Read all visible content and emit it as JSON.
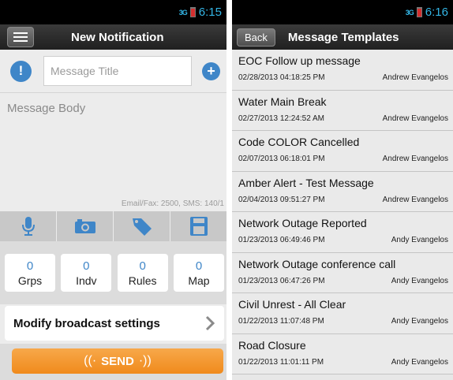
{
  "left_status": {
    "time": "6:15",
    "signal": "3G"
  },
  "right_status": {
    "time": "6:16",
    "signal": "3G"
  },
  "new_notification": {
    "title": "New Notification",
    "message_title_placeholder": "Message Title",
    "message_body_placeholder": "Message Body",
    "limits_text": "Email/Fax: 2500, SMS: 140/1",
    "counters": [
      {
        "value": "0",
        "label": "Grps"
      },
      {
        "value": "0",
        "label": "Indv"
      },
      {
        "value": "0",
        "label": "Rules"
      },
      {
        "value": "0",
        "label": "Map"
      }
    ],
    "modify_label": "Modify broadcast settings",
    "send_label": "SEND"
  },
  "templates": {
    "back_label": "Back",
    "title": "Message Templates",
    "items": [
      {
        "name": "EOC Follow up message",
        "date": "02/28/2013 04:18:25 PM",
        "author": "Andrew Evangelos"
      },
      {
        "name": "Water Main Break",
        "date": "02/27/2013 12:24:52 AM",
        "author": "Andrew Evangelos"
      },
      {
        "name": "Code COLOR Cancelled",
        "date": "02/07/2013 06:18:01 PM",
        "author": "Andrew Evangelos"
      },
      {
        "name": "Amber Alert - Test Message",
        "date": "02/04/2013 09:51:27 PM",
        "author": "Andrew Evangelos"
      },
      {
        "name": "Network Outage Reported",
        "date": "01/23/2013 06:49:46 PM",
        "author": "Andy Evangelos"
      },
      {
        "name": "Network Outage conference call",
        "date": "01/23/2013 06:47:26 PM",
        "author": "Andy Evangelos"
      },
      {
        "name": "Civil Unrest - All Clear",
        "date": "01/22/2013 11:07:48 PM",
        "author": "Andy Evangelos"
      },
      {
        "name": "Road Closure",
        "date": "01/22/2013 11:01:11 PM",
        "author": "Andy Evangelos"
      }
    ]
  },
  "colors": {
    "accent_blue": "#3f86c8",
    "send_orange": "#f08a1c",
    "status_blue": "#33b5e5"
  },
  "icons": [
    "menu-icon",
    "info-icon",
    "plus-icon",
    "microphone-icon",
    "camera-icon",
    "tag-icon",
    "save-icon",
    "chevron-right-icon"
  ]
}
